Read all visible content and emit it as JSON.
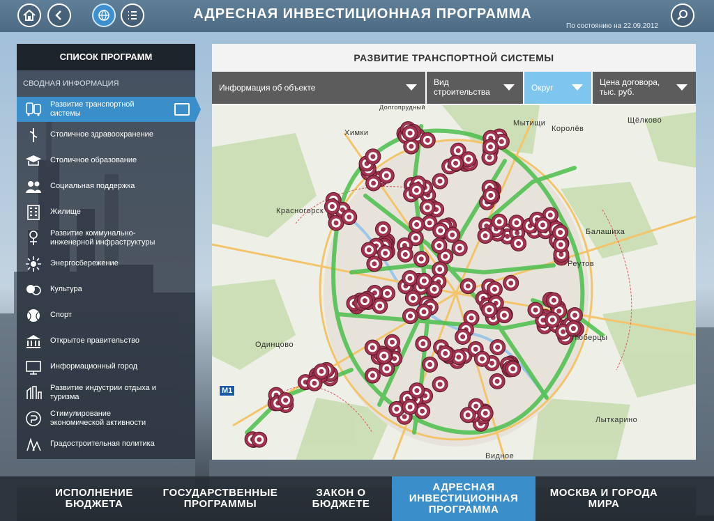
{
  "header": {
    "title": "АДРЕСНАЯ ИНВЕСТИЦИОННАЯ ПРОГРАММА",
    "date_note": "По состоянию на 22.09.2012",
    "buttons": [
      "home-icon",
      "back-icon",
      "globe-icon",
      "list-icon",
      "search-icon"
    ]
  },
  "sidebar": {
    "title": "СПИСОК ПРОГРАММ",
    "summary": "СВОДНАЯ ИНФОРМАЦИЯ",
    "items": [
      {
        "label": "Развитие транспортной системы",
        "icon": "transport-icon",
        "active": true
      },
      {
        "label": "Столичное здравоохранение",
        "icon": "health-icon"
      },
      {
        "label": "Столичное образование",
        "icon": "education-icon"
      },
      {
        "label": "Социальная поддержка",
        "icon": "social-icon"
      },
      {
        "label": "Жилище",
        "icon": "housing-icon"
      },
      {
        "label": "Развитие коммунально-инженерной инфраструктуры",
        "icon": "utilities-icon"
      },
      {
        "label": "Энергосбережение",
        "icon": "energy-icon"
      },
      {
        "label": "Культура",
        "icon": "culture-icon"
      },
      {
        "label": "Спорт",
        "icon": "sport-icon"
      },
      {
        "label": "Открытое правительство",
        "icon": "government-icon"
      },
      {
        "label": "Информационный город",
        "icon": "info-city-icon"
      },
      {
        "label": "Развитие индустрии отдыха и туризма",
        "icon": "tourism-icon"
      },
      {
        "label": "Стимулирование экономической активности",
        "icon": "economy-icon"
      },
      {
        "label": "Градостроительная политика",
        "icon": "urban-icon"
      }
    ]
  },
  "panel": {
    "title": "РАЗВИТИЕ ТРАНСПОРТНОЙ СИСТЕМЫ",
    "filters": [
      {
        "label": "Информация об объекте"
      },
      {
        "label": "Вид строительства"
      },
      {
        "label": "Округ",
        "active": true
      },
      {
        "label": "Цена договора, тыс. руб."
      }
    ],
    "map_labels": [
      "Химки",
      "Мытищи",
      "Королёв",
      "Щёлково",
      "Красногорск",
      "Балашиха",
      "Одинцово",
      "Люберцы",
      "Видное",
      "Лыткарино",
      "Реутов",
      "Долгопрудный"
    ],
    "road_sign": "M1"
  },
  "bottom_nav": [
    {
      "label": "ИСПОЛНЕНИЕ БЮДЖЕТА"
    },
    {
      "label": "ГОСУДАРСТВЕННЫЕ ПРОГРАММЫ"
    },
    {
      "label": "ЗАКОН О БЮДЖЕТЕ"
    },
    {
      "label": "АДРЕСНАЯ ИНВЕСТИЦИОННАЯ ПРОГРАММА",
      "active": true
    },
    {
      "label": "МОСКВА И ГОРОДА МИРА"
    }
  ],
  "colors": {
    "accent": "#3a8fca",
    "filter_active": "#7ec6ee",
    "marker": "#a3344f",
    "route": "#4bbf4b"
  }
}
